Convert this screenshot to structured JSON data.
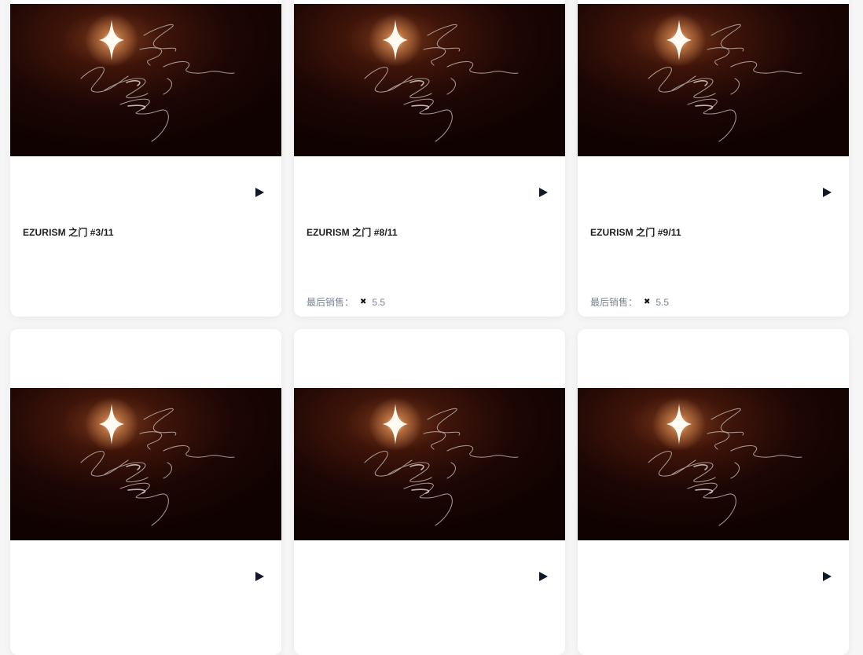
{
  "cards": [
    {
      "title": "EZURISM 之门 #3/11",
      "sale_label": "",
      "sale_icon": "",
      "sale_price": ""
    },
    {
      "title": "EZURISM 之门 #8/11",
      "sale_label": "最后销售：",
      "sale_icon": "✖",
      "sale_price": "5.5"
    },
    {
      "title": "EZURISM 之门 #9/11",
      "sale_label": "最后销售：",
      "sale_icon": "✖",
      "sale_price": "5.5"
    },
    {
      "title": "",
      "sale_label": "",
      "sale_icon": "",
      "sale_price": ""
    },
    {
      "title": "",
      "sale_label": "",
      "sale_icon": "",
      "sale_price": ""
    },
    {
      "title": "",
      "sale_label": "",
      "sale_icon": "",
      "sale_price": ""
    }
  ],
  "icons": {
    "play": "play-icon",
    "artwork": "sparkle-calligraphy-artwork",
    "currency": "x-icon"
  },
  "colors": {
    "artwork_bg_dark": "#120302",
    "artwork_glow": "#f4b37a",
    "play_icon": "#111827",
    "sale_text": "#7b8490"
  }
}
